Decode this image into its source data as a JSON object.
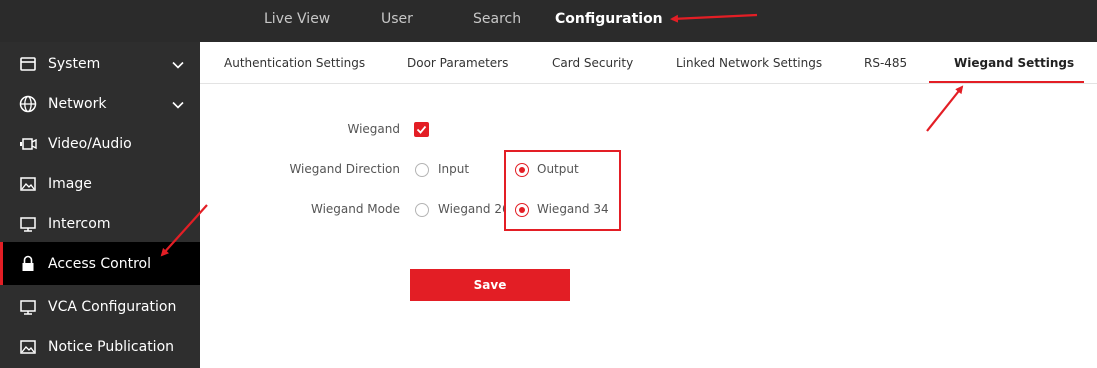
{
  "topnav": {
    "items": [
      {
        "label": "Live View"
      },
      {
        "label": "User"
      },
      {
        "label": "Search"
      },
      {
        "label": "Configuration",
        "active": true
      }
    ]
  },
  "sidebar": {
    "items": [
      {
        "label": "System",
        "icon": "window-icon",
        "expandable": true
      },
      {
        "label": "Network",
        "icon": "globe-icon",
        "expandable": true
      },
      {
        "label": "Video/Audio",
        "icon": "camera-icon"
      },
      {
        "label": "Image",
        "icon": "image-icon"
      },
      {
        "label": "Intercom",
        "icon": "monitor-icon"
      },
      {
        "label": "Access Control",
        "icon": "lock-icon",
        "active": true
      },
      {
        "label": "VCA Configuration",
        "icon": "monitor-icon"
      },
      {
        "label": "Notice Publication",
        "icon": "image-icon"
      }
    ]
  },
  "tabs": {
    "items": [
      {
        "label": "Authentication Settings"
      },
      {
        "label": "Door Parameters"
      },
      {
        "label": "Card Security"
      },
      {
        "label": "Linked Network Settings"
      },
      {
        "label": "RS-485"
      },
      {
        "label": "Wiegand Settings",
        "active": true
      }
    ]
  },
  "form": {
    "wiegand": {
      "label": "Wiegand",
      "checked": true
    },
    "direction": {
      "label": "Wiegand Direction",
      "options": [
        {
          "label": "Input",
          "checked": false
        },
        {
          "label": "Output",
          "checked": true
        }
      ]
    },
    "mode": {
      "label": "Wiegand Mode",
      "options": [
        {
          "label": "Wiegand 26",
          "checked": false
        },
        {
          "label": "Wiegand 34",
          "checked": true
        }
      ]
    },
    "save_label": "Save"
  },
  "colors": {
    "accent": "#e31e25",
    "topbar_bg": "#2b2b2b",
    "sidebar_bg": "#2e2e2e",
    "sidebar_active_bg": "#000000"
  }
}
